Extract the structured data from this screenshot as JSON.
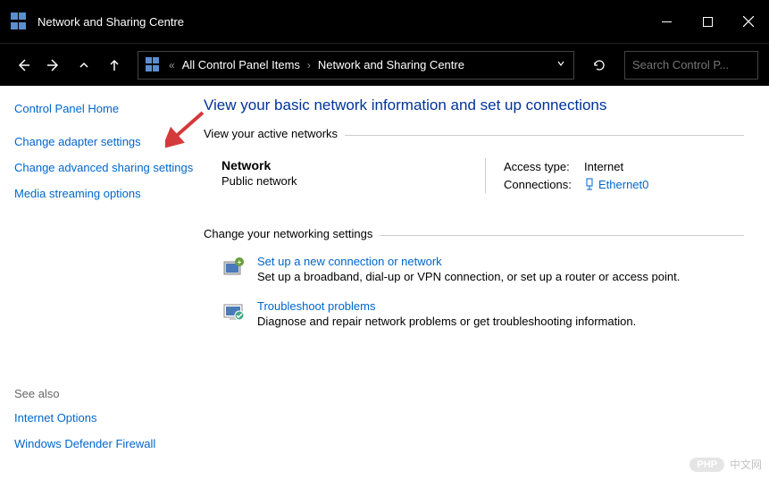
{
  "window": {
    "title": "Network and Sharing Centre"
  },
  "nav": {
    "breadcrumb_prefix": "«",
    "breadcrumb_1": "All Control Panel Items",
    "breadcrumb_2": "Network and Sharing Centre",
    "search_placeholder": "Search Control P..."
  },
  "sidebar": {
    "home": "Control Panel Home",
    "link1": "Change adapter settings",
    "link2": "Change advanced sharing settings",
    "link3": "Media streaming options",
    "see_also_label": "See also",
    "see_also_1": "Internet Options",
    "see_also_2": "Windows Defender Firewall"
  },
  "main": {
    "heading": "View your basic network information and set up connections",
    "active_networks_label": "View your active networks",
    "network": {
      "name": "Network",
      "type": "Public network",
      "access_label": "Access type:",
      "access_value": "Internet",
      "conn_label": "Connections:",
      "conn_value": "Ethernet0"
    },
    "change_label": "Change your networking settings",
    "setup": {
      "title": "Set up a new connection or network",
      "desc": "Set up a broadband, dial-up or VPN connection, or set up a router or access point."
    },
    "troubleshoot": {
      "title": "Troubleshoot problems",
      "desc": "Diagnose and repair network problems or get troubleshooting information."
    }
  },
  "watermark": {
    "badge": "PHP",
    "text": "中文网"
  }
}
